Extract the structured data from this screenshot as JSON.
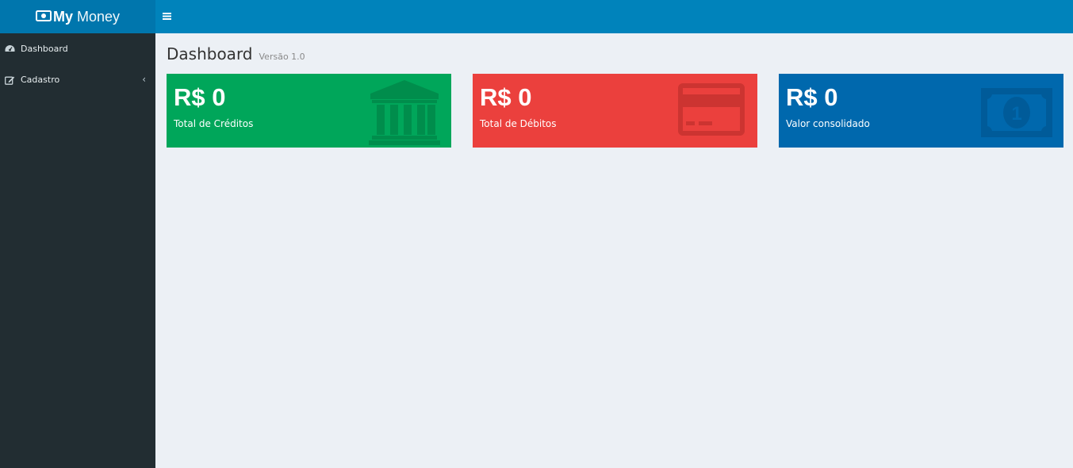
{
  "app": {
    "logo_bold": "My",
    "logo_light": "Money"
  },
  "sidebar": {
    "items": [
      {
        "label": "Dashboard",
        "icon": "dashboard-icon"
      },
      {
        "label": "Cadastro",
        "icon": "edit-icon",
        "has_submenu": true
      }
    ]
  },
  "page": {
    "title": "Dashboard",
    "subtitle": "Versão 1.0"
  },
  "boxes": [
    {
      "value": "R$ 0",
      "label": "Total de Créditos",
      "color": "#00a65a",
      "icon": "bank-icon"
    },
    {
      "value": "R$ 0",
      "label": "Total de Débitos",
      "color": "#eb403d",
      "icon": "credit-card-icon"
    },
    {
      "value": "R$ 0",
      "label": "Valor consolidado",
      "color": "#0068ad",
      "icon": "money-icon"
    }
  ],
  "colors": {
    "header_logo": "#0076ad",
    "header_bar": "#0083bb",
    "sidebar": "#222d32",
    "content_bg": "#ecf0f5"
  }
}
